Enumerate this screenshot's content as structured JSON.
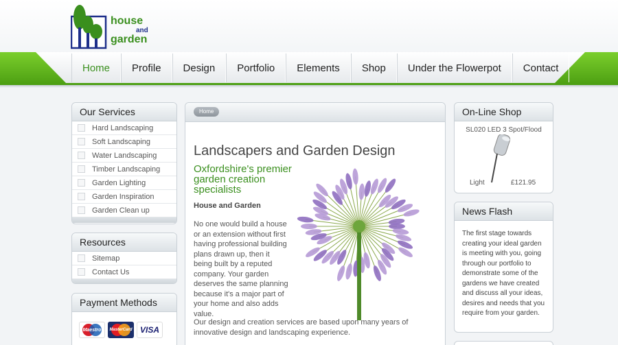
{
  "logo": {
    "word1": "house",
    "word2": "and",
    "word3": "garden"
  },
  "nav": {
    "items": [
      {
        "label": "Home",
        "active": true
      },
      {
        "label": "Profile"
      },
      {
        "label": "Design"
      },
      {
        "label": "Portfolio"
      },
      {
        "label": "Elements"
      },
      {
        "label": "Shop"
      },
      {
        "label": "Under the Flowerpot"
      },
      {
        "label": "Contact"
      }
    ]
  },
  "services": {
    "title": "Our Services",
    "items": [
      "Hard Landscaping",
      "Soft Landscaping",
      "Water Landscaping",
      "Timber Landscaping",
      "Garden Lighting",
      "Garden Inspiration",
      "Garden Clean up"
    ]
  },
  "resources": {
    "title": "Resources",
    "items": [
      "Sitemap",
      "Contact Us"
    ]
  },
  "payments": {
    "title": "Payment Methods",
    "cards": [
      "Maestro",
      "MasterCard",
      "VISA"
    ]
  },
  "breadcrumb": "Home",
  "main": {
    "title": "Landscapers and Garden Design",
    "tagline": "Oxfordshire's premier garden creation specialists",
    "subhead": "House and Garden",
    "para1": "No one would build a house or an extension without first having professional building plans drawn up, then it being built by a reputed company. Your garden deserves the same planning because it's a major part of your home and also adds value.",
    "para2": "Our design and creation services are based upon many years of innovative design and landscaping experience."
  },
  "shop": {
    "title": "On-Line Shop",
    "product": "SL020 LED 3 Spot/Flood",
    "light_label": "Light",
    "price": "£121.95"
  },
  "news": {
    "title": "News Flash",
    "text": "The first stage towards creating your ideal garden is meeting with you, going through our portfolio to demonstrate some of the gardens we have created and discuss all your ideas, desires and needs that you require from your garden."
  },
  "colors": {
    "brand_green": "#3a8f1e",
    "nav_band_green": "#5fb41d",
    "logo_blue": "#1d2e8a"
  }
}
